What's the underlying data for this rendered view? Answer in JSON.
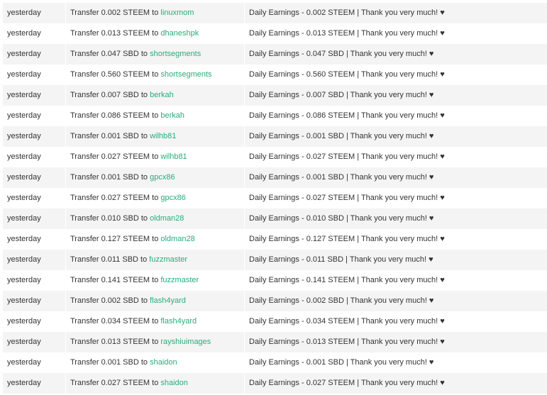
{
  "transfer_history": {
    "rows": [
      {
        "date": "yesterday",
        "action_prefix": "Transfer 0.002 STEEM to ",
        "account": "linuxmom",
        "memo": "Daily Earnings - 0.002 STEEM | Thank you very much! ♥"
      },
      {
        "date": "yesterday",
        "action_prefix": "Transfer 0.013 STEEM to ",
        "account": "dhaneshpk",
        "memo": "Daily Earnings - 0.013 STEEM | Thank you very much! ♥"
      },
      {
        "date": "yesterday",
        "action_prefix": "Transfer 0.047 SBD to ",
        "account": "shortsegments",
        "memo": "Daily Earnings - 0.047 SBD | Thank you very much! ♥"
      },
      {
        "date": "yesterday",
        "action_prefix": "Transfer 0.560 STEEM to ",
        "account": "shortsegments",
        "memo": "Daily Earnings - 0.560 STEEM | Thank you very much! ♥"
      },
      {
        "date": "yesterday",
        "action_prefix": "Transfer 0.007 SBD to ",
        "account": "berkah",
        "memo": "Daily Earnings - 0.007 SBD | Thank you very much! ♥"
      },
      {
        "date": "yesterday",
        "action_prefix": "Transfer 0.086 STEEM to ",
        "account": "berkah",
        "memo": "Daily Earnings - 0.086 STEEM | Thank you very much! ♥"
      },
      {
        "date": "yesterday",
        "action_prefix": "Transfer 0.001 SBD to ",
        "account": "wilhb81",
        "memo": "Daily Earnings - 0.001 SBD | Thank you very much! ♥"
      },
      {
        "date": "yesterday",
        "action_prefix": "Transfer 0.027 STEEM to ",
        "account": "wilhb81",
        "memo": "Daily Earnings - 0.027 STEEM | Thank you very much! ♥"
      },
      {
        "date": "yesterday",
        "action_prefix": "Transfer 0.001 SBD to ",
        "account": "gpcx86",
        "memo": "Daily Earnings - 0.001 SBD | Thank you very much! ♥"
      },
      {
        "date": "yesterday",
        "action_prefix": "Transfer 0.027 STEEM to ",
        "account": "gpcx86",
        "memo": "Daily Earnings - 0.027 STEEM | Thank you very much! ♥"
      },
      {
        "date": "yesterday",
        "action_prefix": "Transfer 0.010 SBD to ",
        "account": "oldman28",
        "memo": "Daily Earnings - 0.010 SBD | Thank you very much! ♥"
      },
      {
        "date": "yesterday",
        "action_prefix": "Transfer 0.127 STEEM to ",
        "account": "oldman28",
        "memo": "Daily Earnings - 0.127 STEEM | Thank you very much! ♥"
      },
      {
        "date": "yesterday",
        "action_prefix": "Transfer 0.011 SBD to ",
        "account": "fuzzmaster",
        "memo": "Daily Earnings - 0.011 SBD | Thank you very much! ♥"
      },
      {
        "date": "yesterday",
        "action_prefix": "Transfer 0.141 STEEM to ",
        "account": "fuzzmaster",
        "memo": "Daily Earnings - 0.141 STEEM | Thank you very much! ♥"
      },
      {
        "date": "yesterday",
        "action_prefix": "Transfer 0.002 SBD to ",
        "account": "flash4yard",
        "memo": "Daily Earnings - 0.002 SBD | Thank you very much! ♥"
      },
      {
        "date": "yesterday",
        "action_prefix": "Transfer 0.034 STEEM to ",
        "account": "flash4yard",
        "memo": "Daily Earnings - 0.034 STEEM | Thank you very much! ♥"
      },
      {
        "date": "yesterday",
        "action_prefix": "Transfer 0.013 STEEM to ",
        "account": "rayshiuimages",
        "memo": "Daily Earnings - 0.013 STEEM | Thank you very much! ♥"
      },
      {
        "date": "yesterday",
        "action_prefix": "Transfer 0.001 SBD to ",
        "account": "shaidon",
        "memo": "Daily Earnings - 0.001 SBD | Thank you very much! ♥"
      },
      {
        "date": "yesterday",
        "action_prefix": "Transfer 0.027 STEEM to ",
        "account": "shaidon",
        "memo": "Daily Earnings - 0.027 STEEM | Thank you very much! ♥"
      }
    ]
  },
  "colors": {
    "link": "#27ad7b",
    "row_striped": "#f4f4f4",
    "row_plain": "#ffffff",
    "text": "#333333"
  }
}
